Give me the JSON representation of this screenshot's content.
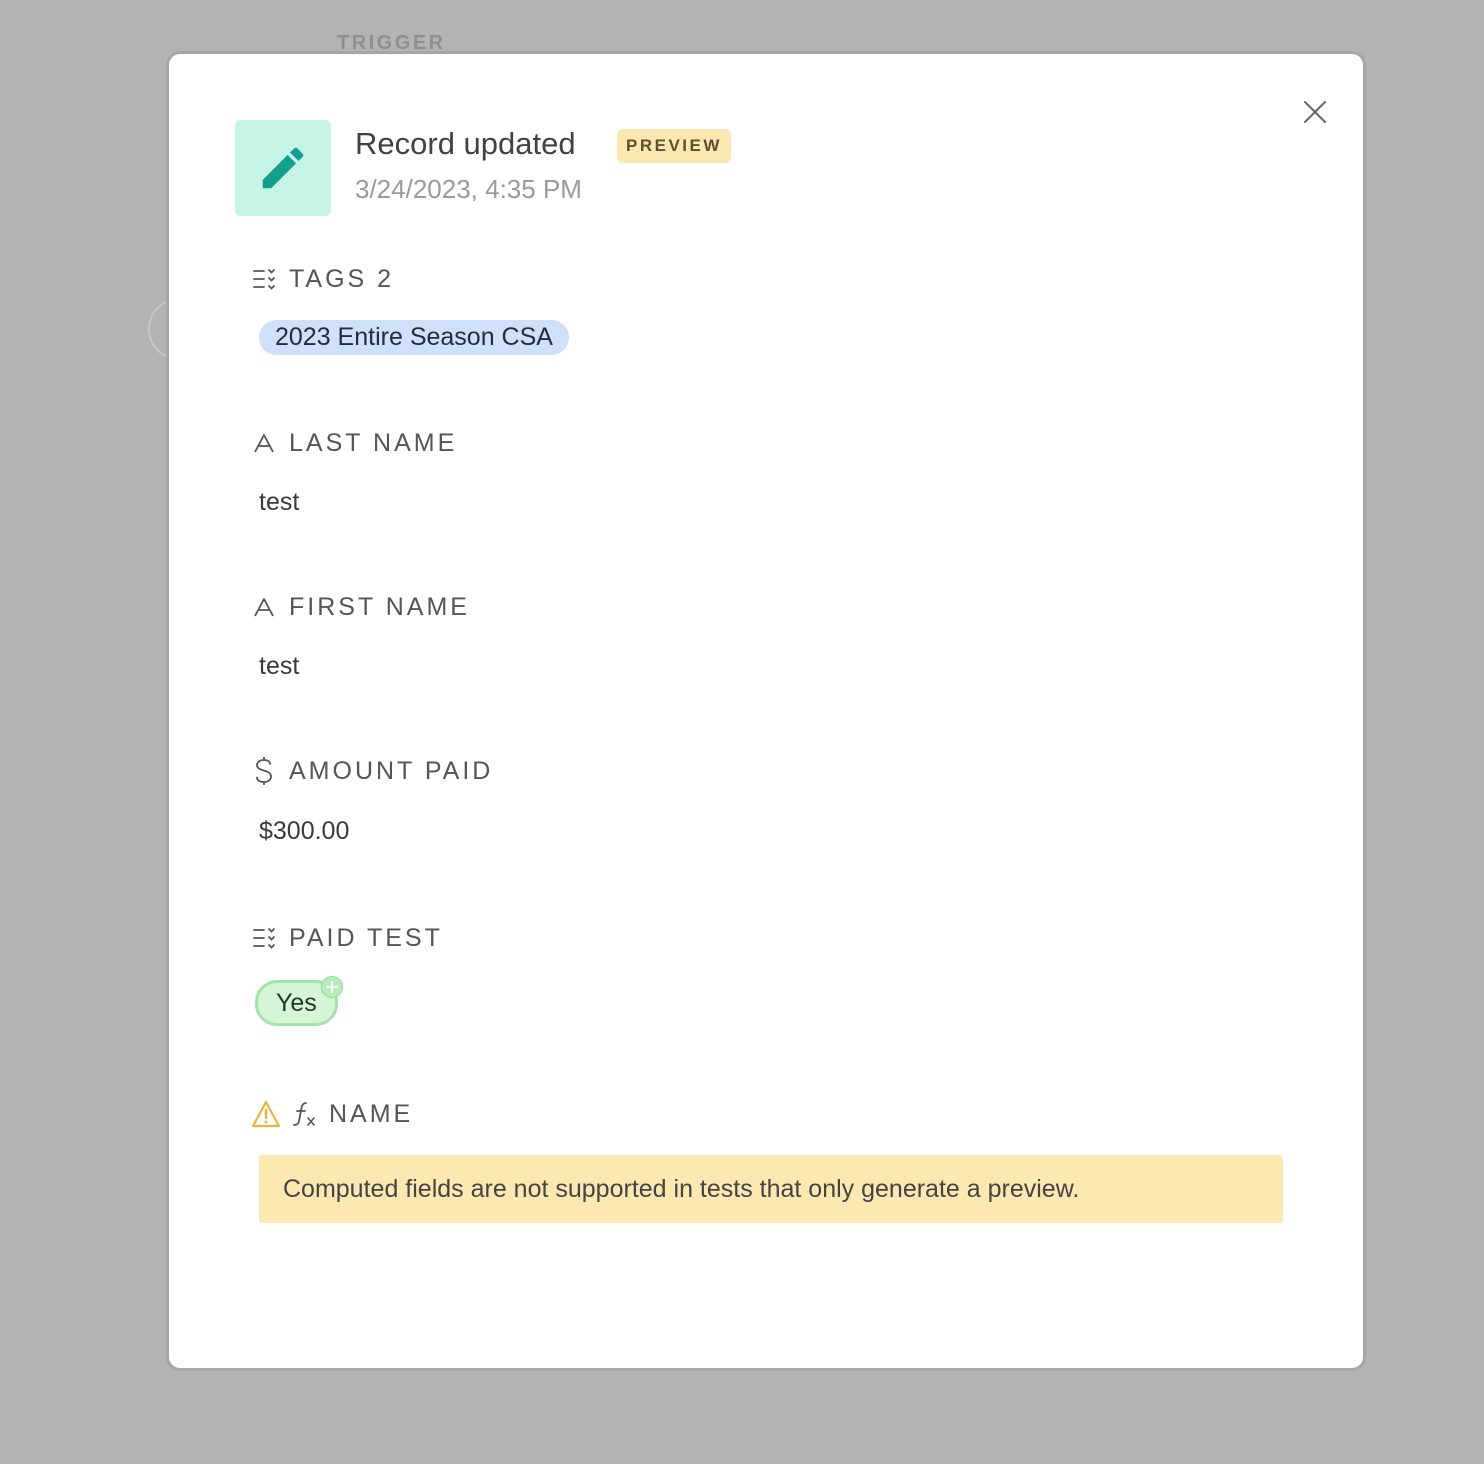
{
  "background": {
    "trigger_label": "TRIGGER"
  },
  "header": {
    "title": "Record updated",
    "badge": "PREVIEW",
    "timestamp": "3/24/2023, 4:35 PM",
    "icon": "pencil-icon"
  },
  "fields": [
    {
      "label": "TAGS 2",
      "icon": "multi-select-icon",
      "value": "2023 Entire Season CSA"
    },
    {
      "label": "LAST NAME",
      "icon": "text-field-icon",
      "value": "test"
    },
    {
      "label": "FIRST NAME",
      "icon": "text-field-icon",
      "value": "test"
    },
    {
      "label": "AMOUNT PAID",
      "icon": "dollar-icon",
      "value": "$300.00"
    },
    {
      "label": "PAID TEST",
      "icon": "multi-select-icon",
      "value": "Yes"
    },
    {
      "label": "NAME",
      "icon": "formula-icon",
      "warning_icon": "warning-icon",
      "notice": "Computed fields are not supported in tests that only generate a preview."
    }
  ],
  "colors": {
    "overlay": "#b3b3b3",
    "icon_bg": "#c6f4e6",
    "icon_fg": "#139e8e",
    "badge_bg": "#fbe7b0",
    "tag_blue": "#cfe0fb",
    "tag_green": "#d5f5d6",
    "notice_bg": "#fde8b1",
    "warning": "#e8b53a"
  }
}
